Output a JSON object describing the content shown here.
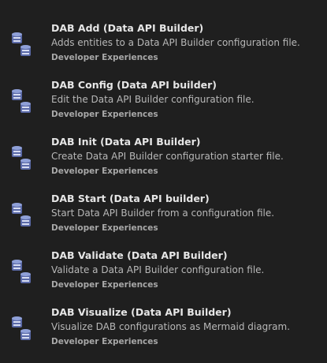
{
  "extensions": [
    {
      "title": "DAB Add (Data API Builder)",
      "description": "Adds entities to a Data API Builder configuration file.",
      "publisher": "Developer Experiences",
      "icon": "database-pair-icon"
    },
    {
      "title": "DAB Config (Data API builder)",
      "description": "Edit the Data API Builder configuration file.",
      "publisher": "Developer Experiences",
      "icon": "database-pair-icon"
    },
    {
      "title": "DAB Init (Data API Builder)",
      "description": "Create Data API Builder configuration starter file.",
      "publisher": "Developer Experiences",
      "icon": "database-pair-icon"
    },
    {
      "title": "DAB Start (Data API builder)",
      "description": "Start Data API Builder from a configuration file.",
      "publisher": "Developer Experiences",
      "icon": "database-pair-icon"
    },
    {
      "title": "DAB Validate (Data API Builder)",
      "description": "Validate a Data API Builder configuration file.",
      "publisher": "Developer Experiences",
      "icon": "database-pair-icon"
    },
    {
      "title": "DAB Visualize (Data API Builder)",
      "description": "Visualize DAB configurations as Mermaid diagram.",
      "publisher": "Developer Experiences",
      "icon": "database-pair-icon"
    }
  ]
}
